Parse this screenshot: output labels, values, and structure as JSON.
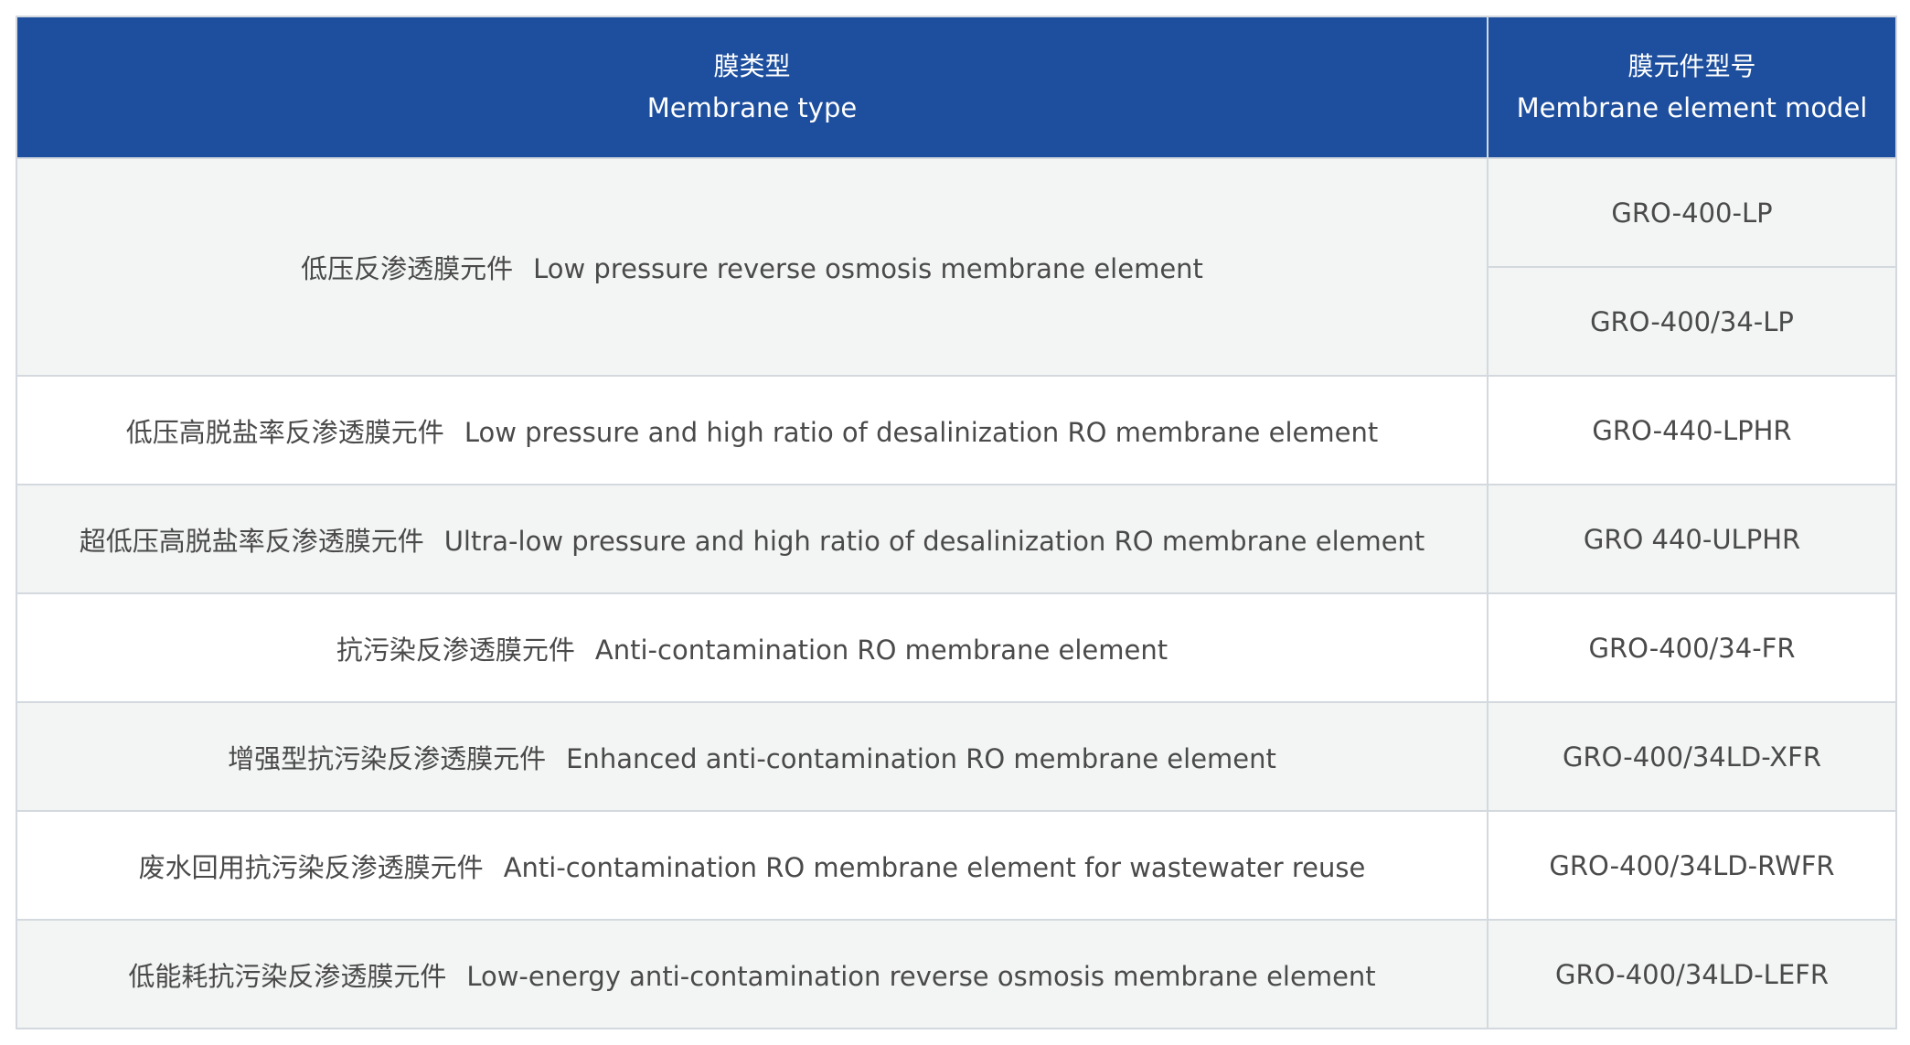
{
  "header": {
    "type_zh": "膜类型",
    "type_en": "Membrane type",
    "model_zh": "膜元件型号",
    "model_en": "Membrane element model"
  },
  "rows": [
    {
      "type_zh": "低压反渗透膜元件",
      "type_en": "Low pressure reverse osmosis membrane element",
      "models": [
        "GRO-400-LP",
        "GRO-400/34-LP"
      ]
    },
    {
      "type_zh": "低压高脱盐率反渗透膜元件",
      "type_en": "Low pressure and high ratio of desalinization RO membrane element",
      "models": [
        "GRO-440-LPHR"
      ]
    },
    {
      "type_zh": "超低压高脱盐率反渗透膜元件",
      "type_en": "Ultra-low pressure and high ratio of desalinization RO membrane element",
      "models": [
        "GRO 440-ULPHR"
      ]
    },
    {
      "type_zh": "抗污染反渗透膜元件",
      "type_en": "Anti-contamination RO membrane element",
      "models": [
        "GRO-400/34-FR"
      ]
    },
    {
      "type_zh": "增强型抗污染反渗透膜元件",
      "type_en": "Enhanced anti-contamination RO membrane element",
      "models": [
        "GRO-400/34LD-XFR"
      ]
    },
    {
      "type_zh": "废水回用抗污染反渗透膜元件",
      "type_en": "Anti-contamination RO membrane element for wastewater reuse",
      "models": [
        "GRO-400/34LD-RWFR"
      ]
    },
    {
      "type_zh": "低能耗抗污染反渗透膜元件",
      "type_en": "Low-energy anti-contamination reverse osmosis membrane element",
      "models": [
        "GRO-400/34LD-LEFR"
      ]
    }
  ],
  "colors": {
    "header_bg": "#1e4f9e",
    "header_text": "#ffffff",
    "row_shade": "#f3f5f4",
    "border": "#d3d9de",
    "body_text": "#4a4a4a"
  }
}
